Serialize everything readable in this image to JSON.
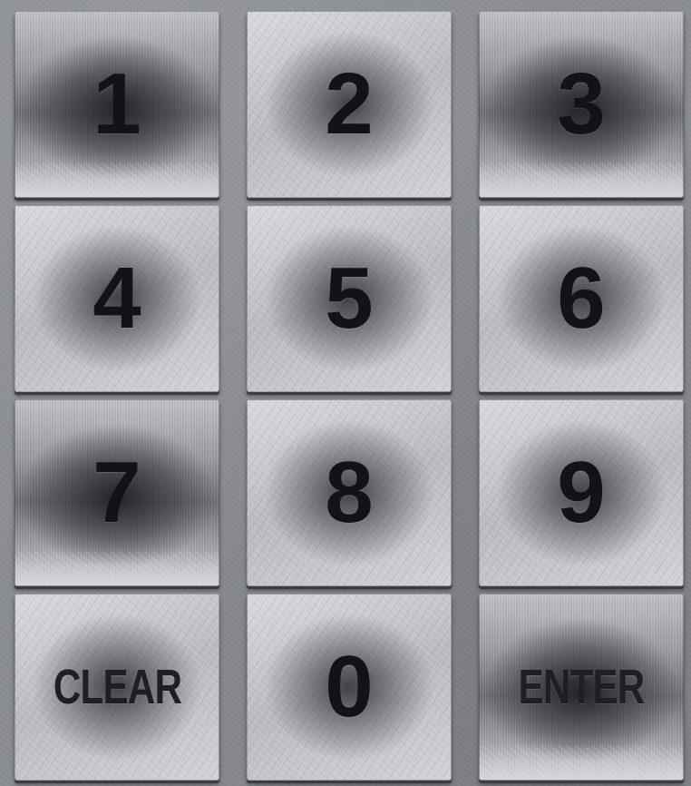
{
  "keypad": {
    "keys": [
      {
        "id": "1",
        "label": "1"
      },
      {
        "id": "2",
        "label": "2"
      },
      {
        "id": "3",
        "label": "3"
      },
      {
        "id": "4",
        "label": "4"
      },
      {
        "id": "5",
        "label": "5"
      },
      {
        "id": "6",
        "label": "6"
      },
      {
        "id": "7",
        "label": "7"
      },
      {
        "id": "8",
        "label": "8"
      },
      {
        "id": "9",
        "label": "9"
      },
      {
        "id": "clear",
        "label": "CLEAR"
      },
      {
        "id": "0",
        "label": "0"
      },
      {
        "id": "enter",
        "label": "ENTER"
      }
    ]
  },
  "colors": {
    "background": "#8a8d91",
    "label": "#121316"
  }
}
